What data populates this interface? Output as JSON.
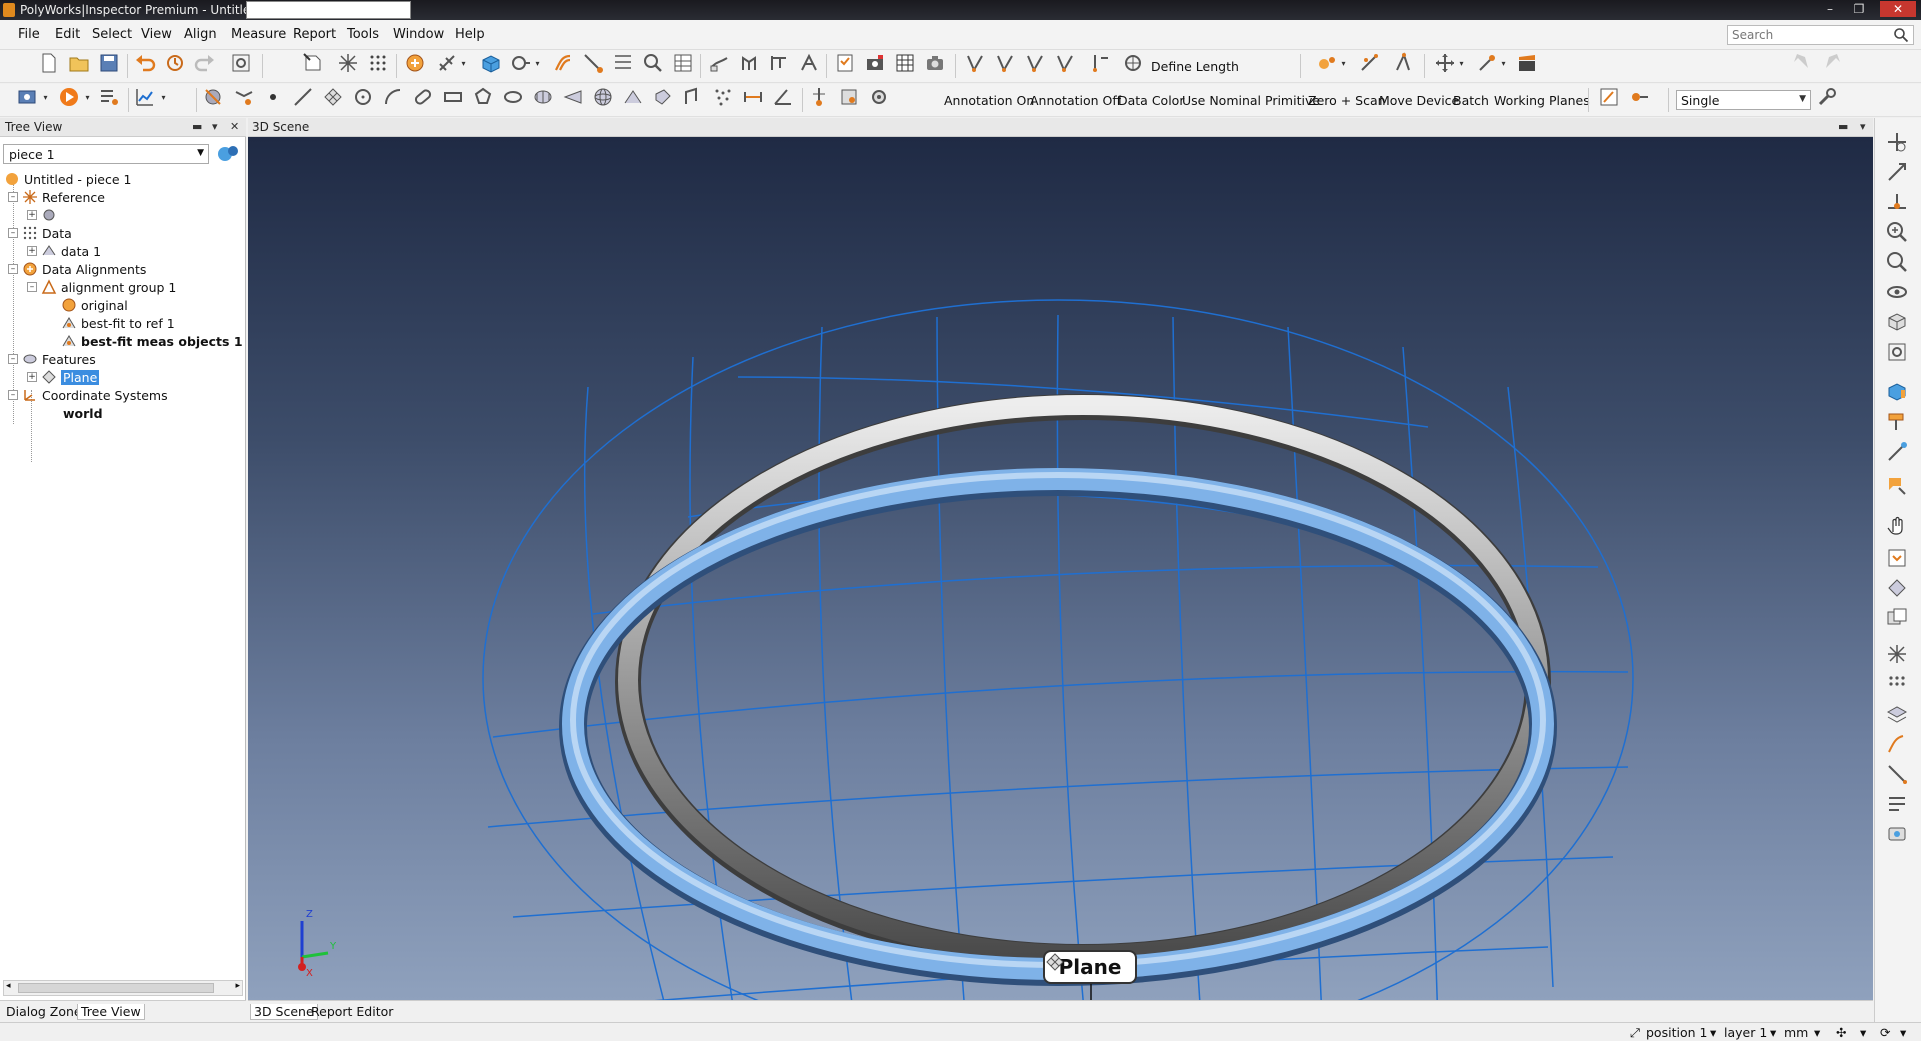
{
  "window": {
    "title": "PolyWorks|Inspector Premium - Untitled*",
    "minimize": "–",
    "restore": "❐",
    "close": "✕"
  },
  "menu": [
    "File",
    "Edit",
    "Select",
    "View",
    "Align",
    "Measure",
    "Report",
    "Tools",
    "Window",
    "Help"
  ],
  "search": {
    "placeholder": "Search"
  },
  "toolbar1": {
    "define_length_label": "Define Length"
  },
  "toolbar2": {
    "annotation_on": "Annotation On",
    "annotation_off": "Annotation Off",
    "data_color": "Data Color",
    "use_nominal_primitive": "Use Nominal Primitive",
    "zero_scan": "Zero + Scan",
    "move_device": "Move Device",
    "batch": "Batch",
    "working_planes": "Working Planes",
    "mode_value": "Single"
  },
  "tree_panel": {
    "header": "Tree View",
    "piece_value": "piece 1",
    "items": [
      {
        "label": "Untitled - piece 1"
      },
      {
        "label": "Reference"
      },
      {
        "label": ""
      },
      {
        "label": "Data"
      },
      {
        "label": "data 1"
      },
      {
        "label": "Data Alignments"
      },
      {
        "label": "alignment group 1"
      },
      {
        "label": "original"
      },
      {
        "label": "best-fit to ref 1"
      },
      {
        "label": "best-fit meas objects 1"
      },
      {
        "label": "Features"
      },
      {
        "label": "Plane"
      },
      {
        "label": "Coordinate Systems"
      },
      {
        "label": "world"
      }
    ],
    "tabs": [
      "Dialog Zone",
      "Tree View"
    ]
  },
  "scene": {
    "header": "3D Scene",
    "plane_label": "Plane",
    "axes": {
      "z": "Z",
      "y": "Y",
      "x": "X"
    },
    "tabs": [
      "3D Scene",
      "Report Editor"
    ]
  },
  "status": {
    "position": "position 1",
    "layer": "layer 1",
    "units": "mm"
  },
  "colors": {
    "scan_ring": "#7fb2e8",
    "reference_ring": "#c9c9c9",
    "plane_grid": "#1f6fd1",
    "selection": "#3b8de0"
  }
}
